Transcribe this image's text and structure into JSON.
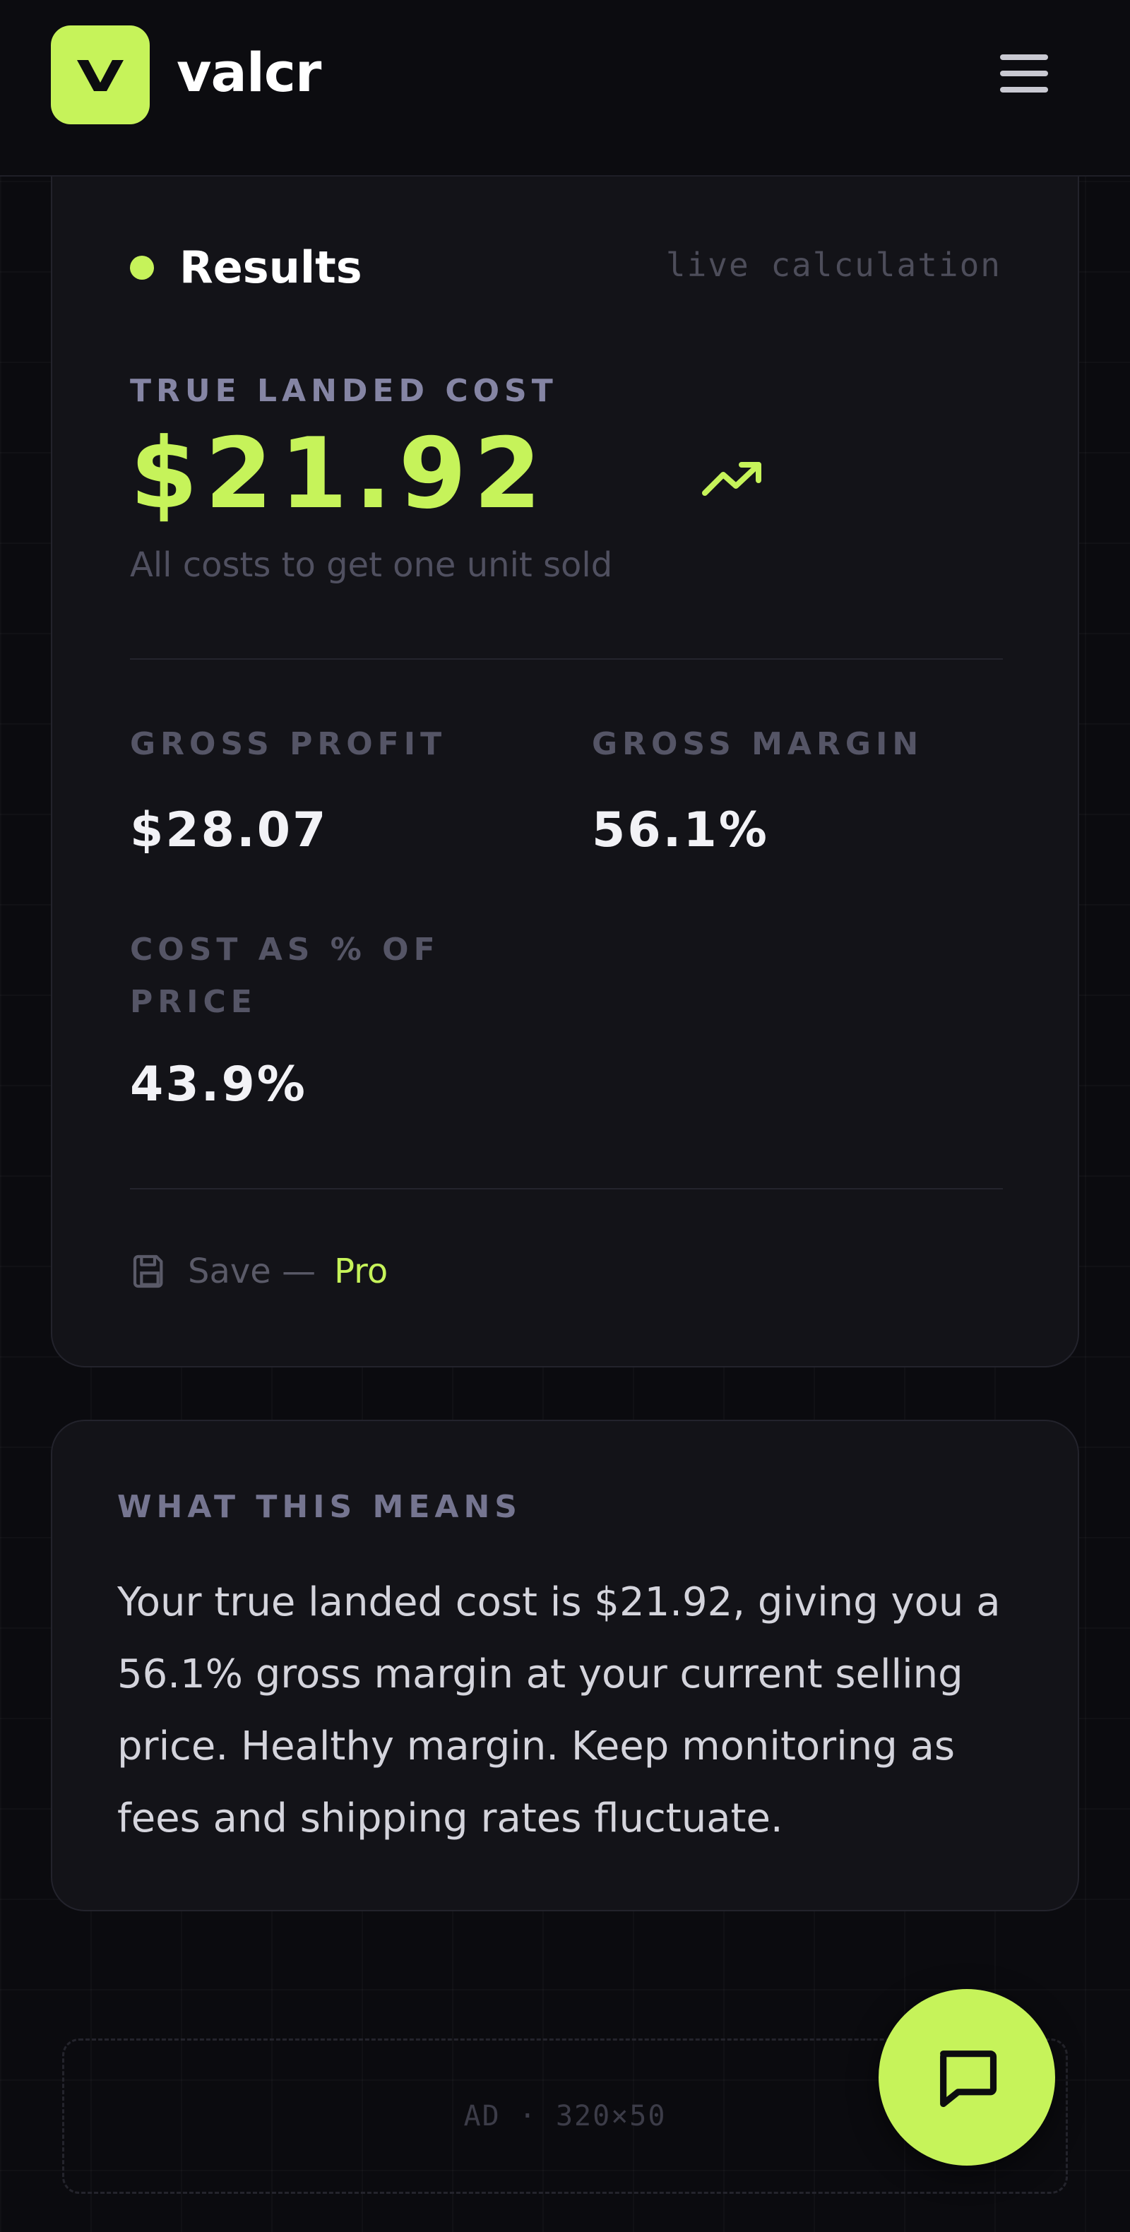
{
  "header": {
    "brand_mark": "V",
    "brand_name": "valcr",
    "menu_icon": "hamburger-menu-icon"
  },
  "results": {
    "title": "Results",
    "live_label": "live calculation",
    "true_landed_cost_label": "TRUE LANDED COST",
    "true_landed_cost_value": "$21.92",
    "true_landed_cost_sub": "All costs to get one unit sold",
    "trend_icon": "trending-up-icon",
    "metrics": {
      "gross_profit_label": "GROSS PROFIT",
      "gross_profit_value": "$28.07",
      "gross_margin_label": "GROSS MARGIN",
      "gross_margin_value": "56.1%",
      "cost_pct_label": "COST AS % OF PRICE",
      "cost_pct_value": "43.9%"
    },
    "save_label": "Save —",
    "save_pro": "Pro",
    "save_icon": "floppy-disk-icon"
  },
  "what_this_means": {
    "label": "WHAT THIS MEANS",
    "text": "Your true landed cost is $21.92, giving you a 56.1% gross margin at your current selling price. Healthy margin. Keep monitoring as fees and shipping rates fluctuate."
  },
  "ad": {
    "text": "AD · 320×50"
  },
  "chat": {
    "icon": "chat-bubble-icon"
  },
  "colors": {
    "accent": "#c6f35a",
    "background": "#0b0b0f",
    "card": "#131318"
  }
}
